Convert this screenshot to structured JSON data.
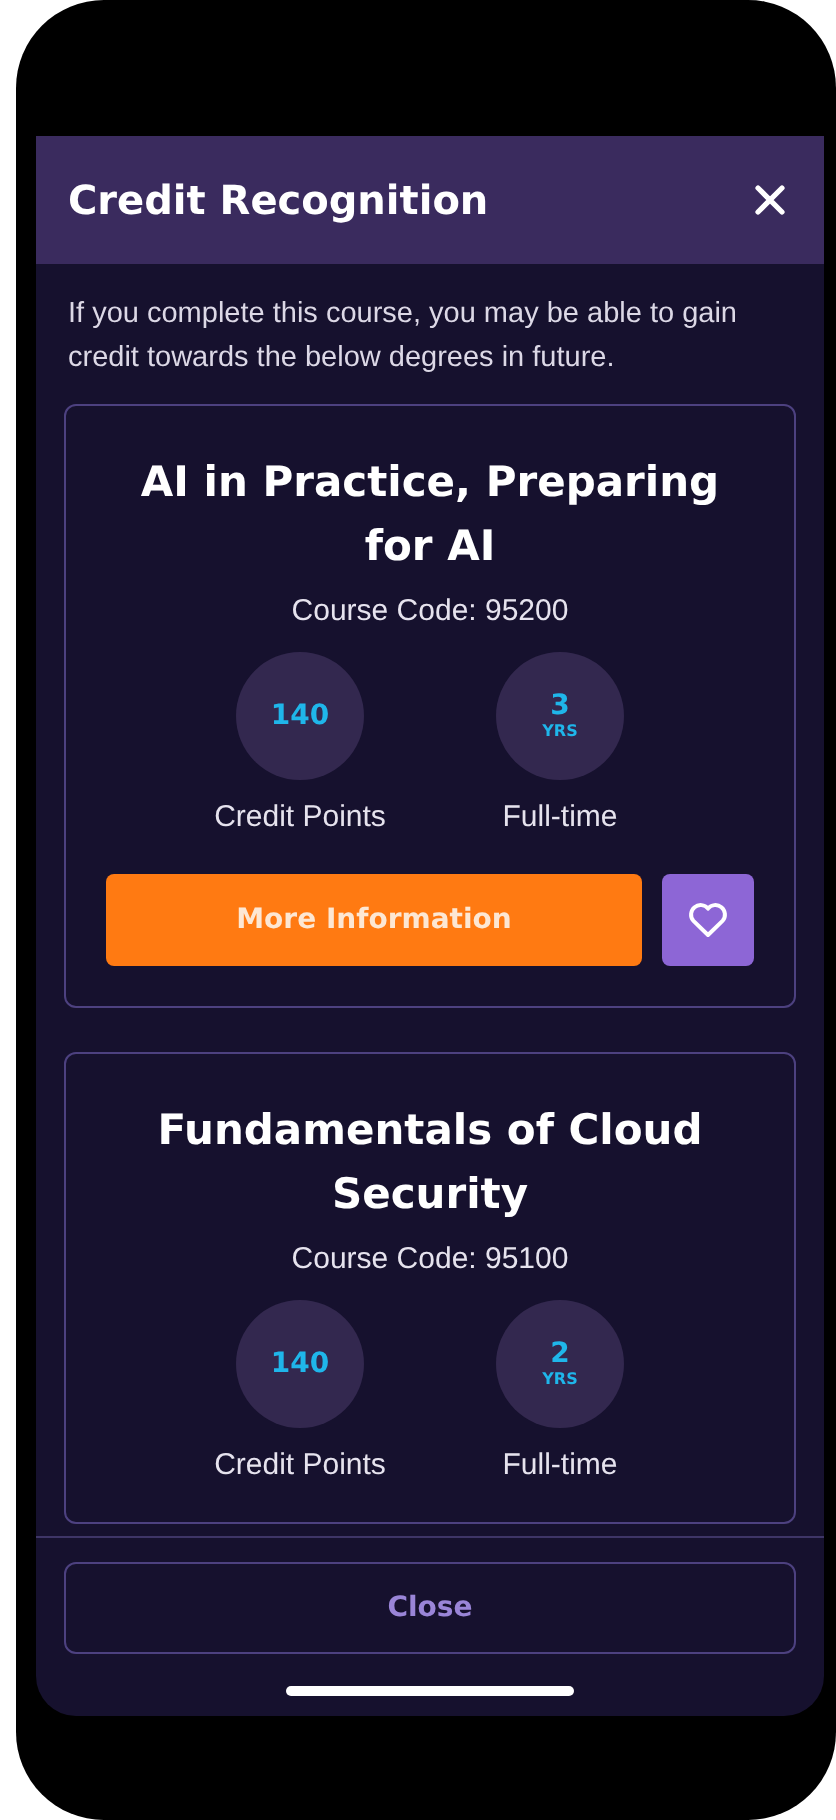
{
  "dialog": {
    "title": "Credit Recognition",
    "intro": "If you complete this course, you may be able to gain credit towards the below degrees in future."
  },
  "courses": [
    {
      "title": "AI in Practice, Preparing for AI",
      "code": "Course Code: 95200",
      "stats": [
        {
          "value": "140",
          "label": "Credit Points"
        },
        {
          "value": "3",
          "unit": "YRS",
          "label": "Full-time"
        }
      ],
      "button": "More Information"
    },
    {
      "title": "Fundamentals of Cloud Security",
      "code": "Course Code: 95100",
      "stats": [
        {
          "value": "140",
          "label": "Credit Points"
        },
        {
          "value": "2",
          "unit": "YRS",
          "label": "Full-time"
        }
      ]
    }
  ],
  "footer": {
    "button": "Close"
  }
}
